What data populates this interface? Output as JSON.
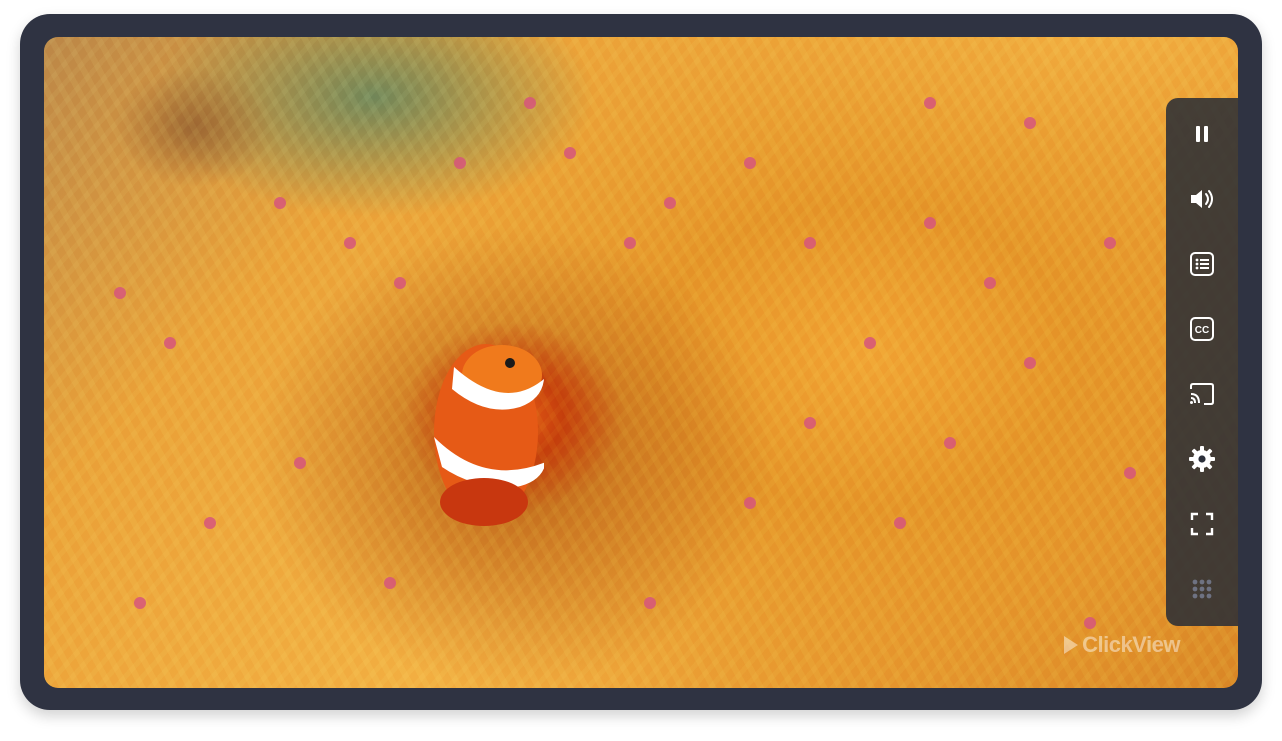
{
  "player": {
    "watermark": "ClickView",
    "controls": [
      {
        "name": "pause-button",
        "icon": "pause-icon"
      },
      {
        "name": "volume-button",
        "icon": "volume-icon"
      },
      {
        "name": "chapters-button",
        "icon": "list-icon"
      },
      {
        "name": "captions-button",
        "icon": "cc-icon"
      },
      {
        "name": "cast-button",
        "icon": "cast-icon"
      },
      {
        "name": "settings-button",
        "icon": "gear-icon"
      },
      {
        "name": "fullscreen-button",
        "icon": "fullscreen-icon"
      },
      {
        "name": "apps-button",
        "icon": "grid-icon"
      }
    ],
    "colors": {
      "frame": "#2f3342",
      "control_bar": "#282c36",
      "icon": "#ffffff"
    }
  }
}
